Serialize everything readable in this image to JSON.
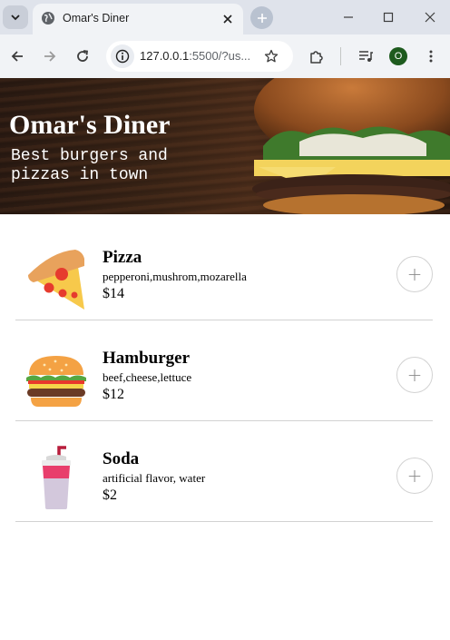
{
  "browser": {
    "tab_title": "Omar's Diner",
    "url_host": "127.0.0.1",
    "url_rest": ":5500/?us...",
    "profile_initial": "O"
  },
  "hero": {
    "title": "Omar's Diner",
    "tagline": "Best burgers and pizzas in town"
  },
  "menu": [
    {
      "name": "Pizza",
      "ingredients": "pepperoni,mushrom,mozarella",
      "price": "$14",
      "icon": "pizza-icon",
      "add_label": "+"
    },
    {
      "name": "Hamburger",
      "ingredients": "beef,cheese,lettuce",
      "price": "$12",
      "icon": "hamburger-icon",
      "add_label": "+"
    },
    {
      "name": "Soda",
      "ingredients": "artificial flavor, water",
      "price": "$2",
      "icon": "soda-icon",
      "add_label": "+"
    }
  ]
}
